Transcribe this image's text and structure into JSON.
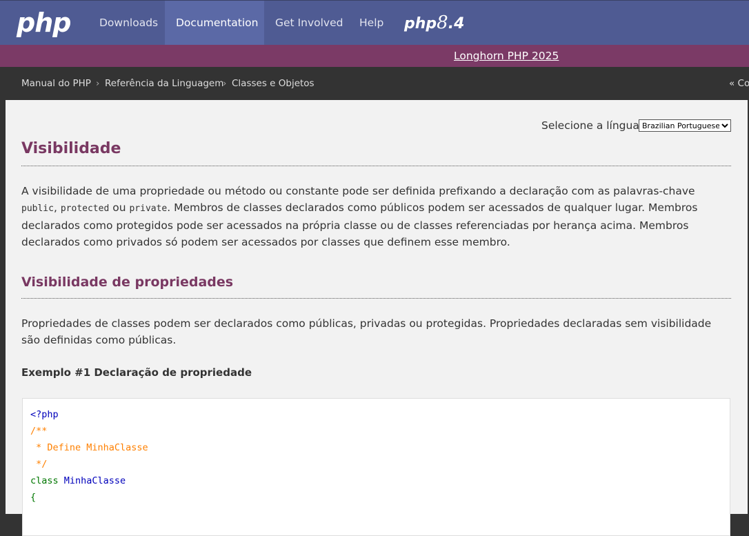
{
  "nav": {
    "logo": "php",
    "items": [
      {
        "label": "Downloads"
      },
      {
        "label": "Documentation"
      },
      {
        "label": "Get Involved"
      },
      {
        "label": "Help"
      }
    ],
    "release_logo": {
      "prefix": "php",
      "major": "8",
      "minor": ".4"
    }
  },
  "banner": {
    "link": "Longhorn PHP 2025"
  },
  "breadcrumbs": {
    "items": [
      "Manual do PHP",
      "Referência da Linguagem",
      "Classes e Objetos"
    ],
    "separator": "›",
    "prev": "« Co"
  },
  "language": {
    "label": "Selecione a língua:",
    "selected": "Brazilian Portuguese"
  },
  "page": {
    "title": "Visibilidade",
    "intro": {
      "p1": "A visibilidade de uma propriedade ou método ou constante pode ser definida prefixando a declaração com as palavras-chave ",
      "kw_public": "public",
      "comma": ",",
      "kw_protected": "protected",
      "or": " ou ",
      "kw_private": "private",
      "p2": ". Membros de classes declarados como públicos podem ser acessados de qualquer lugar. Membros declarados como protegidos pode ser acessados na própria classe ou de classes referenciadas por herança acima. Membros declarados como privados só podem ser acessados por classes que definem esse membro."
    },
    "section_title": "Visibilidade de propriedades",
    "section_text": "Propriedades de classes podem ser declarados como públicas, privadas ou protegidas. Propriedades declaradas sem visibilidade são definidas como públicas.",
    "example_title": "Exemplo #1 Declaração de propriedade",
    "code": {
      "line1": "<?php",
      "line2": "/**",
      "line3": " * Define MinhaClasse",
      "line4": " */",
      "line5_kw": "class ",
      "line5_name": "MinhaClasse",
      "line6": "{"
    }
  },
  "colors": {
    "nav_bg": "#4F5B93",
    "banner_bg": "#7B3A66",
    "heading": "#793862"
  }
}
